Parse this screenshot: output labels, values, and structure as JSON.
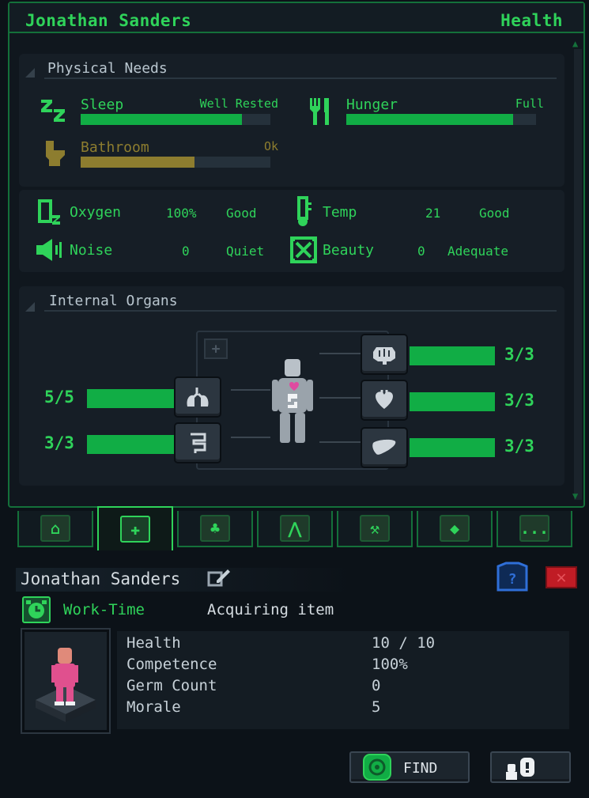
{
  "header": {
    "name": "Jonathan Sanders",
    "panel": "Health"
  },
  "physical_needs": {
    "title": "Physical Needs",
    "sleep": {
      "label": "Sleep",
      "status": "Well Rested",
      "fill": 0.85,
      "icon": "zz-icon"
    },
    "hunger": {
      "label": "Hunger",
      "status": "Full",
      "fill": 0.88,
      "icon": "fork-knife-icon"
    },
    "bathroom": {
      "label": "Bathroom",
      "status": "Ok",
      "fill": 0.6,
      "icon": "toilet-icon"
    }
  },
  "environment": {
    "oxygen": {
      "label": "Oxygen",
      "value": "100%",
      "status": "Good"
    },
    "temp": {
      "label": "Temp",
      "value": "21",
      "status": "Good"
    },
    "noise": {
      "label": "Noise",
      "value": "0",
      "status": "Quiet"
    },
    "beauty": {
      "label": "Beauty",
      "value": "0",
      "status": "Adequate"
    }
  },
  "organs": {
    "title": "Internal Organs",
    "lungs": {
      "count": "5/5",
      "fill": 1.0
    },
    "intestines": {
      "count": "3/3",
      "fill": 1.0
    },
    "brain": {
      "count": "3/3",
      "fill": 1.0
    },
    "heart": {
      "count": "3/3",
      "fill": 1.0
    },
    "liver": {
      "count": "3/3",
      "fill": 1.0
    }
  },
  "tabs": [
    {
      "name": "home",
      "glyph": "⌂"
    },
    {
      "name": "health",
      "glyph": "✚"
    },
    {
      "name": "nature",
      "glyph": "♣"
    },
    {
      "name": "rank",
      "glyph": "⋀"
    },
    {
      "name": "work",
      "glyph": "⚒"
    },
    {
      "name": "helmet",
      "glyph": "◆"
    },
    {
      "name": "more",
      "glyph": "..."
    }
  ],
  "character": {
    "name": "Jonathan Sanders",
    "schedule": "Work-Time",
    "task": "Acquiring item",
    "attributes": [
      {
        "label": "Health",
        "value": "10 / 10"
      },
      {
        "label": "Competence",
        "value": "100%"
      },
      {
        "label": "Germ Count",
        "value": "0"
      },
      {
        "label": "Morale",
        "value": "5"
      }
    ],
    "find_label": "FIND"
  },
  "colors": {
    "accent": "#2fd35a",
    "bar": "#11ad45",
    "warn": "#8d7d2f",
    "border": "#14703a",
    "close": "#c01c25",
    "help": "#2f6fd8"
  }
}
